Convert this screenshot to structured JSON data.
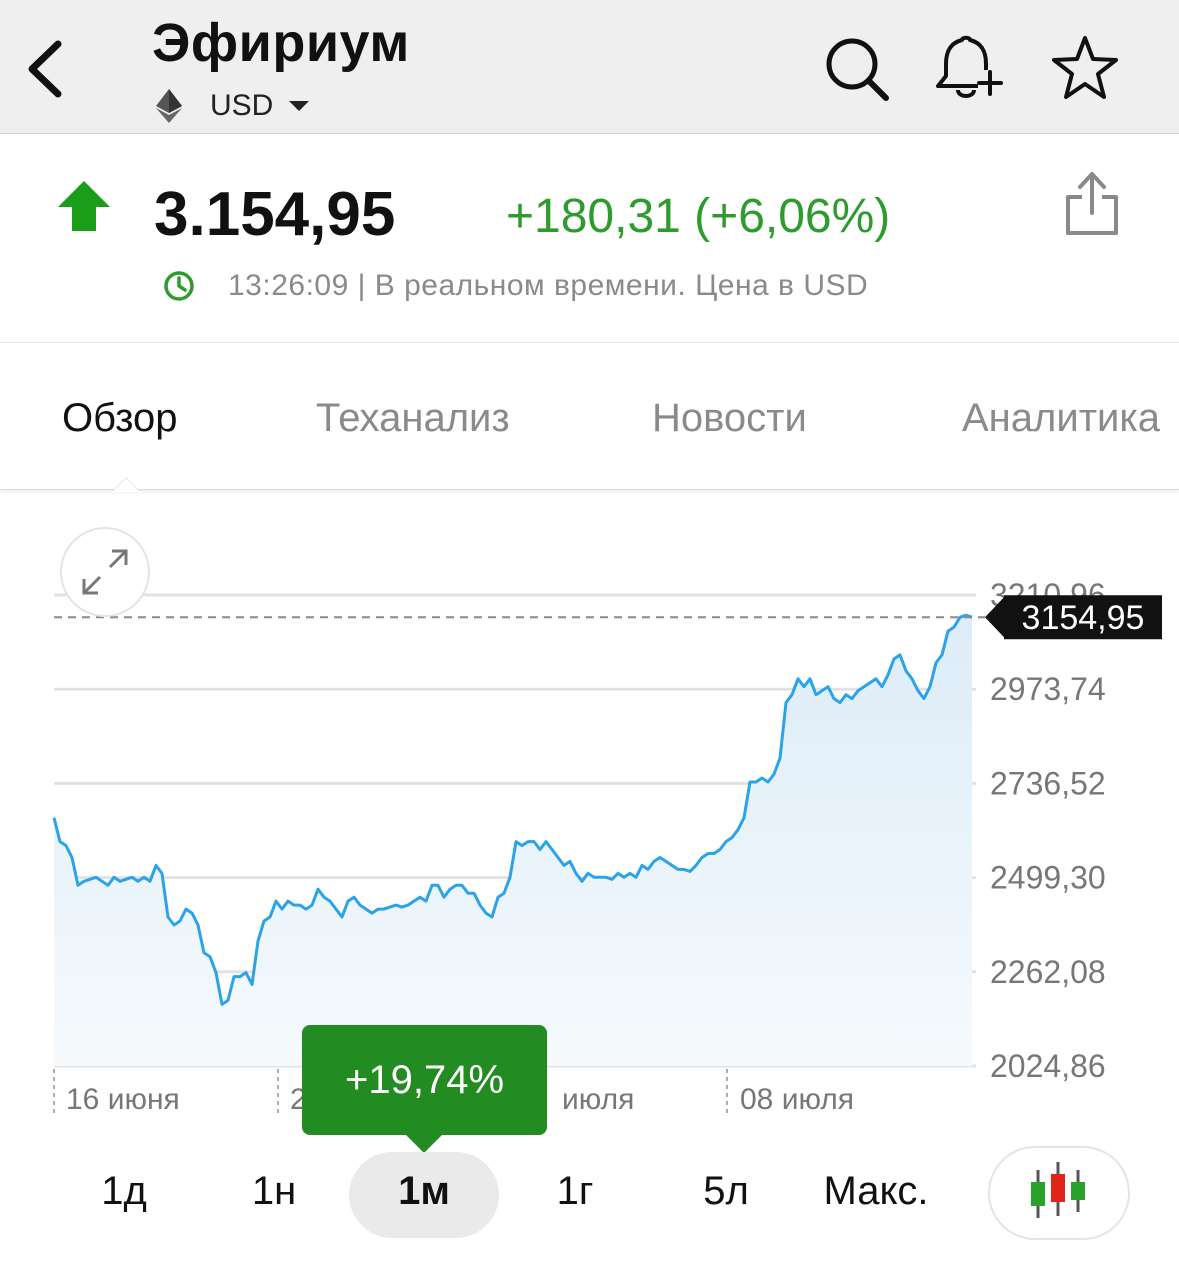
{
  "header": {
    "title": "Эфириум",
    "currency": "USD",
    "icons": [
      "back-icon",
      "ethereum-icon",
      "search-icon",
      "bell-plus-icon",
      "star-icon"
    ]
  },
  "quote": {
    "price": "3.154,95",
    "change": "+180,31 (+6,06%)",
    "timestamp": "13:26:09 | В реальном времени. Цена в USD",
    "up_color": "#1a9e1a",
    "change_color": "#2e9b2e"
  },
  "tabs": [
    {
      "label": "Обзор",
      "active": true
    },
    {
      "label": "Теханализ",
      "active": false
    },
    {
      "label": "Новости",
      "active": false
    },
    {
      "label": "Аналитика",
      "active": false
    }
  ],
  "chart_data": {
    "type": "area",
    "series_color": "#2ba3e8",
    "y_ticks": [
      "3210,96",
      "2973,74",
      "2736,52",
      "2499,30",
      "2262,08",
      "2024,86"
    ],
    "ylim": [
      2024.86,
      3210.96
    ],
    "x_ticks": [
      "16 июня",
      "2",
      "июля",
      "08 июля"
    ],
    "current_value_label": "3154,95",
    "current_value": 3154.95,
    "values": [
      2650,
      2590,
      2580,
      2550,
      2480,
      2490,
      2495,
      2500,
      2490,
      2480,
      2500,
      2490,
      2495,
      2500,
      2490,
      2500,
      2490,
      2530,
      2510,
      2400,
      2380,
      2390,
      2420,
      2410,
      2380,
      2310,
      2300,
      2260,
      2180,
      2190,
      2250,
      2250,
      2260,
      2230,
      2340,
      2390,
      2400,
      2440,
      2420,
      2440,
      2430,
      2430,
      2420,
      2430,
      2470,
      2450,
      2440,
      2420,
      2400,
      2440,
      2450,
      2430,
      2420,
      2410,
      2420,
      2420,
      2425,
      2430,
      2425,
      2430,
      2440,
      2450,
      2440,
      2480,
      2480,
      2450,
      2470,
      2480,
      2480,
      2460,
      2460,
      2430,
      2410,
      2400,
      2450,
      2460,
      2500,
      2590,
      2580,
      2590,
      2590,
      2570,
      2590,
      2570,
      2550,
      2530,
      2540,
      2510,
      2490,
      2510,
      2500,
      2500,
      2500,
      2495,
      2510,
      2500,
      2510,
      2500,
      2530,
      2520,
      2540,
      2550,
      2540,
      2530,
      2520,
      2520,
      2515,
      2530,
      2550,
      2560,
      2560,
      2570,
      2590,
      2600,
      2620,
      2650,
      2740,
      2740,
      2750,
      2740,
      2760,
      2800,
      2940,
      2960,
      3000,
      2980,
      3000,
      2960,
      2970,
      2980,
      2950,
      2940,
      2960,
      2950,
      2970,
      2980,
      2990,
      3000,
      2980,
      3010,
      3050,
      3060,
      3020,
      3000,
      2970,
      2950,
      2980,
      3040,
      3060,
      3120,
      3130,
      3155,
      3160,
      3154.95
    ],
    "change_badge": "+19,74%"
  },
  "periods": {
    "items": [
      "1д",
      "1н",
      "1м",
      "1г",
      "5л",
      "Макс."
    ],
    "active": "1м"
  },
  "candles_icon": "candlestick-chart-icon"
}
